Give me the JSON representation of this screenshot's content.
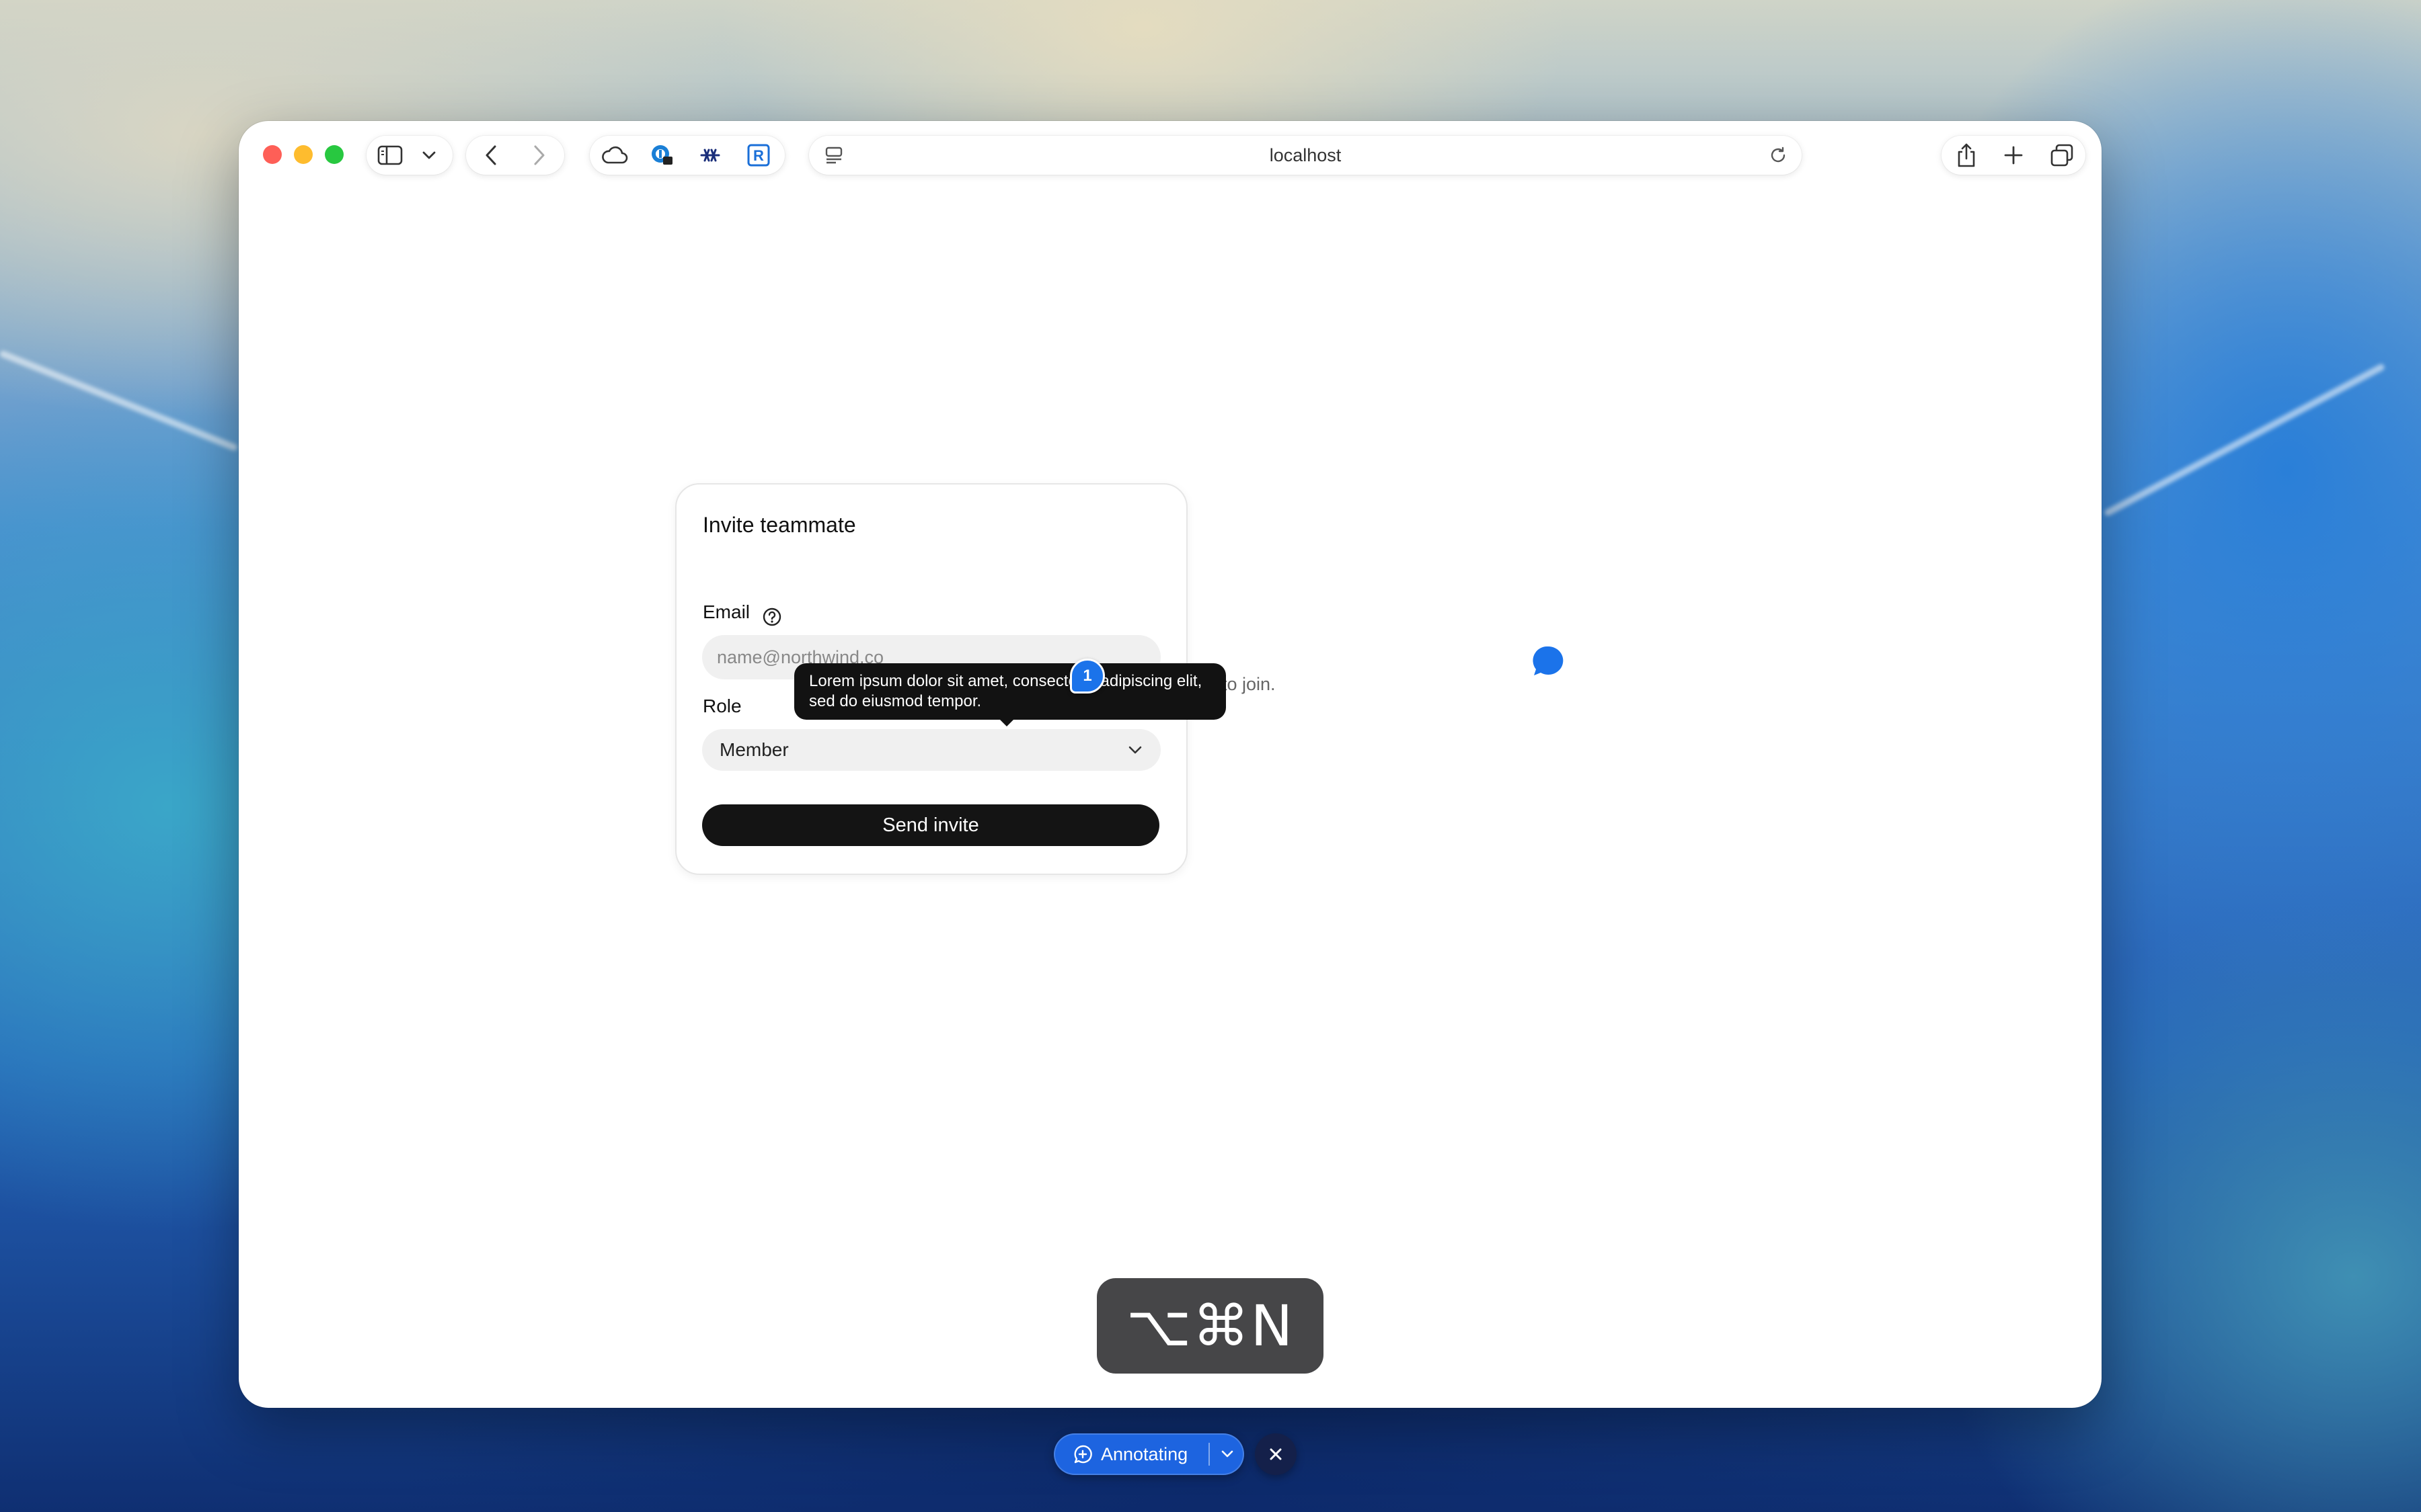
{
  "browser": {
    "url": "localhost",
    "toolbar_icons": [
      "sidebar-icon",
      "chevron-down-icon",
      "back-icon",
      "forward-icon",
      "cloud-icon",
      "password-extension-icon",
      "asterisk-extension-icon",
      "r-extension-icon",
      "page-menu-icon",
      "reload-icon",
      "share-icon",
      "new-tab-icon",
      "tab-overview-icon"
    ]
  },
  "card": {
    "title": "Invite teammate",
    "description_visible": "to join.",
    "email_label": "Email",
    "email_placeholder": "name@northwind.co",
    "role_label": "Role",
    "role_value": "Member",
    "submit_label": "Send invite"
  },
  "tooltip": {
    "text": "Lorem ipsum dolor sit amet, consectetur adipiscing elit, sed do eiusmod tempor."
  },
  "annotation_marker": {
    "number": "1"
  },
  "shortcut_hud": {
    "keys": "⌥⌘N"
  },
  "annotate_bar": {
    "label": "Annotating"
  },
  "colors": {
    "accent": "#1d64e0",
    "marker": "#1b73ea",
    "button": "#141414"
  }
}
